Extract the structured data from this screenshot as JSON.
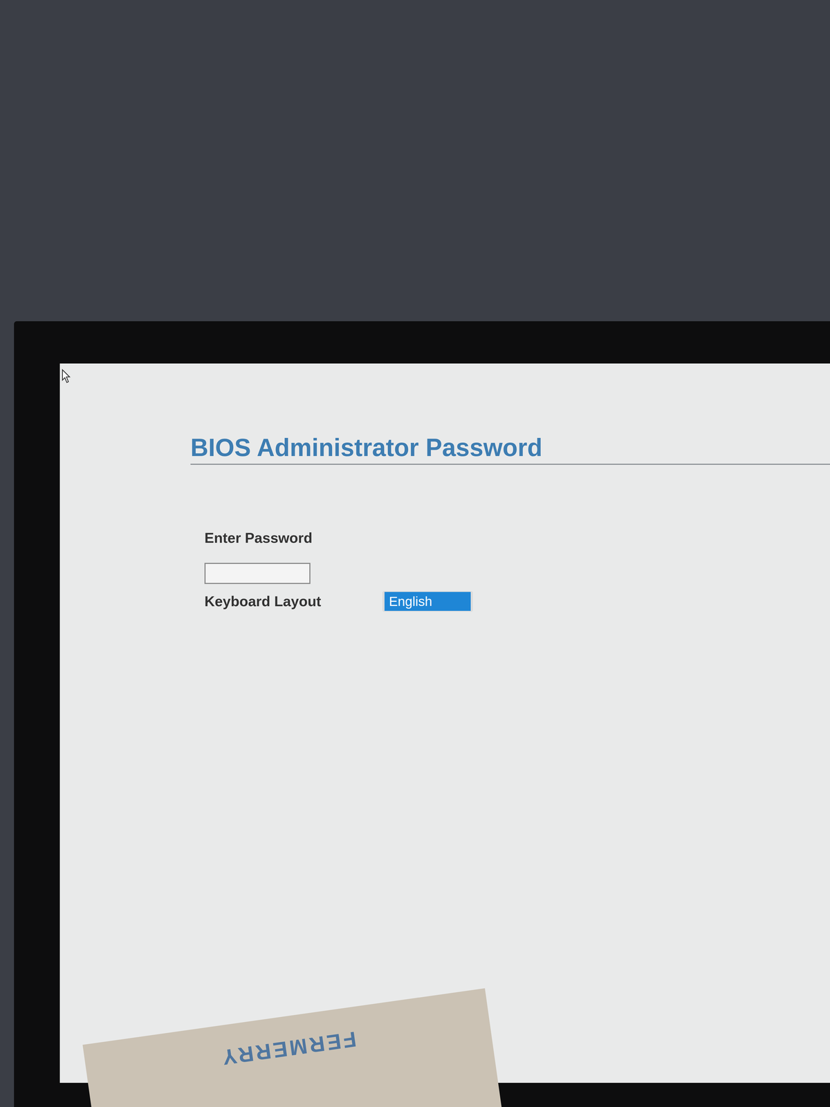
{
  "screen": {
    "title": "BIOS Administrator Password",
    "password": {
      "label": "Enter Password",
      "value": ""
    },
    "keyboard_layout": {
      "label": "Keyboard Layout",
      "value": "English",
      "selected": true
    }
  },
  "box": {
    "label": "FERMERRY"
  }
}
